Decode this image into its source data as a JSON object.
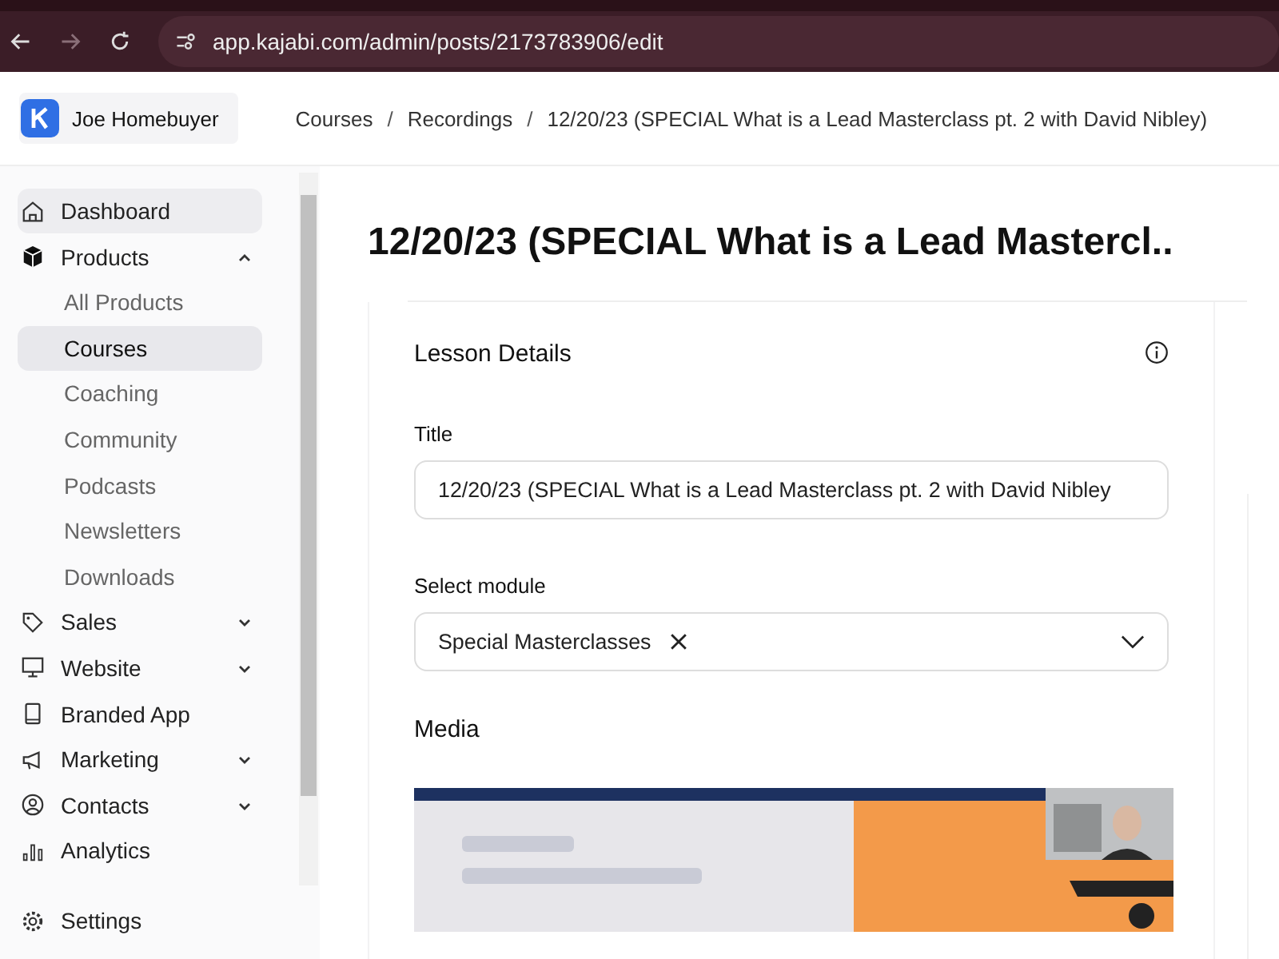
{
  "browser": {
    "url": "app.kajabi.com/admin/posts/2173783906/edit"
  },
  "header": {
    "site_name": "Joe Homebuyer",
    "breadcrumb_separator": "/",
    "breadcrumbs": [
      "Courses",
      "Recordings",
      "12/20/23 (SPECIAL What is a Lead Masterclass pt. 2 with David Nibley)"
    ]
  },
  "sidebar": {
    "items": [
      {
        "label": "Dashboard",
        "selected": false,
        "hovered": true
      },
      {
        "label": "Products",
        "selected": false,
        "hovered": false,
        "expanded": true,
        "children": [
          {
            "label": "All Products",
            "selected": false
          },
          {
            "label": "Courses",
            "selected": true
          },
          {
            "label": "Coaching",
            "selected": false
          },
          {
            "label": "Community",
            "selected": false
          },
          {
            "label": "Podcasts",
            "selected": false
          },
          {
            "label": "Newsletters",
            "selected": false
          },
          {
            "label": "Downloads",
            "selected": false
          }
        ]
      },
      {
        "label": "Sales",
        "selected": false,
        "hovered": false,
        "expanded": false
      },
      {
        "label": "Website",
        "selected": false,
        "hovered": false,
        "expanded": false
      },
      {
        "label": "Branded App",
        "selected": false,
        "hovered": false
      },
      {
        "label": "Marketing",
        "selected": false,
        "hovered": false,
        "expanded": false
      },
      {
        "label": "Contacts",
        "selected": false,
        "hovered": false,
        "expanded": false
      },
      {
        "label": "Analytics",
        "selected": false,
        "hovered": false
      }
    ],
    "footer": {
      "label": "Settings"
    }
  },
  "page": {
    "heading": "12/20/23 (SPECIAL What is a Lead Mastercl..",
    "card": {
      "title": "Lesson Details",
      "title_field": {
        "label": "Title",
        "value": "12/20/23 (SPECIAL What is a Lead Masterclass pt. 2 with David Nibley"
      },
      "module_field": {
        "label": "Select module",
        "chips": [
          "Special Masterclasses"
        ]
      },
      "media": {
        "label": "Media",
        "kind": "picture"
      }
    }
  }
}
